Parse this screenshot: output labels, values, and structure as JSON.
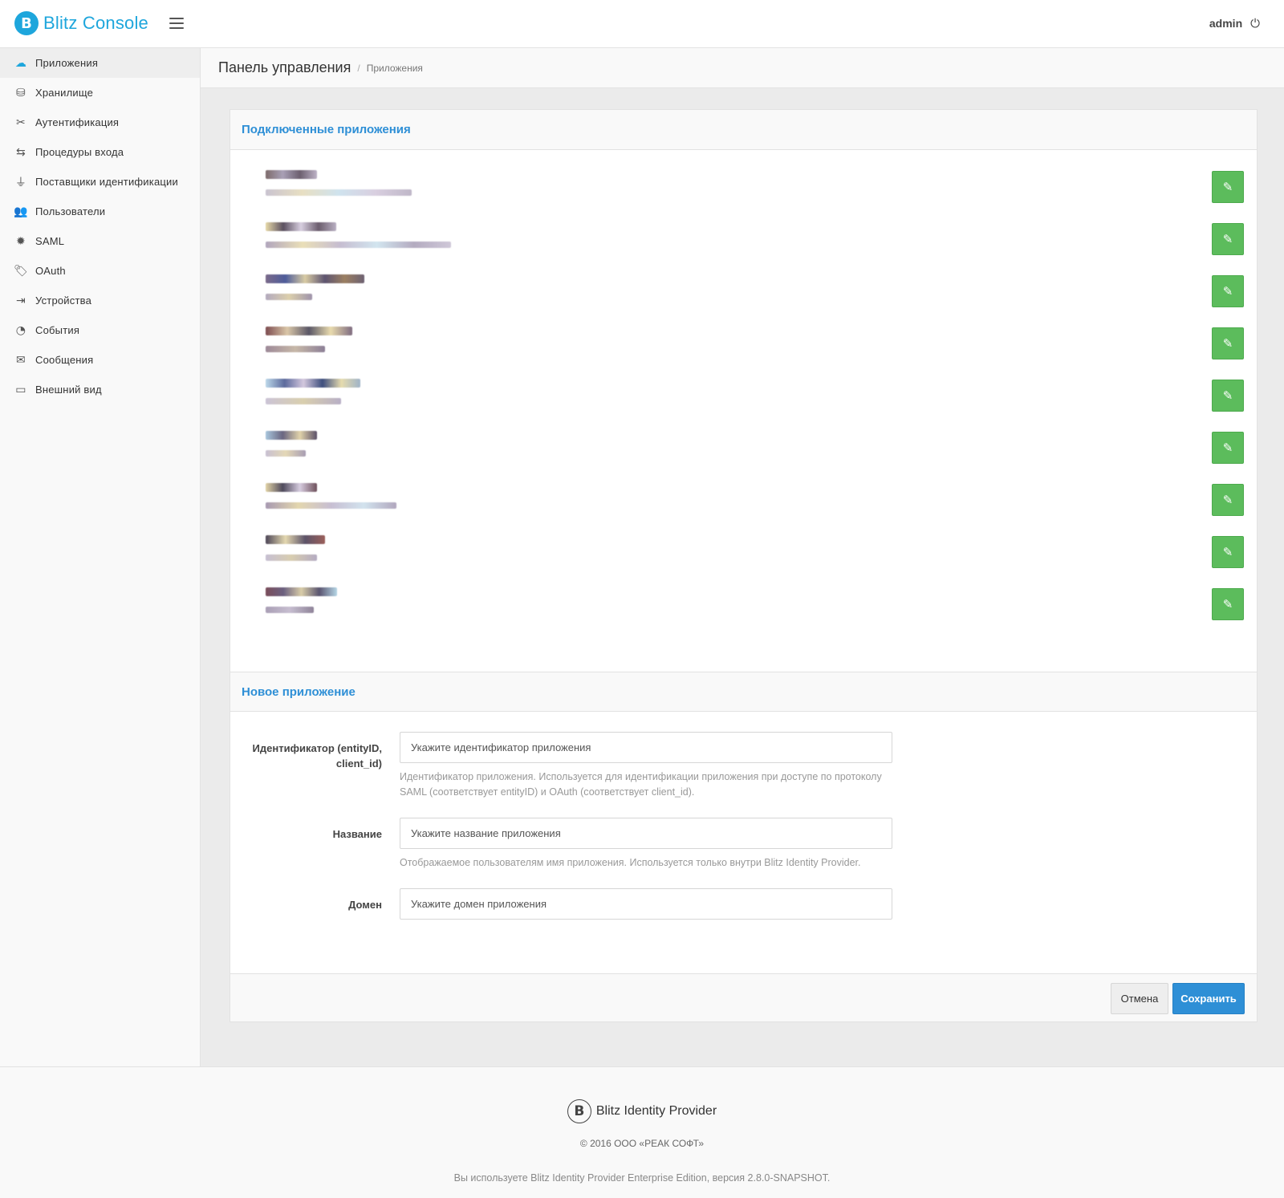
{
  "header": {
    "logo_letter": "B",
    "app_title": "Blitz Console",
    "user_name": "admin",
    "power_icon": "⏻"
  },
  "sidebar": {
    "items": [
      {
        "label": "Приложения",
        "icon": "☁",
        "active": true
      },
      {
        "label": "Хранилище",
        "icon": "⛁"
      },
      {
        "label": "Аутентификация",
        "icon": "✂"
      },
      {
        "label": "Процедуры входа",
        "icon": "⇆"
      },
      {
        "label": "Поставщики идентификации",
        "icon": "⏚"
      },
      {
        "label": "Пользователи",
        "icon": "👥"
      },
      {
        "label": "SAML",
        "icon": "✹"
      },
      {
        "label": "OAuth",
        "icon": "🏷"
      },
      {
        "label": "Устройства",
        "icon": "⇥"
      },
      {
        "label": "События",
        "icon": "◔"
      },
      {
        "label": "Сообщения",
        "icon": "✉"
      },
      {
        "label": "Внешний вид",
        "icon": "▭"
      }
    ]
  },
  "page": {
    "title": "Панель управления",
    "breadcrumb_sep": "/",
    "breadcrumb": "Приложения"
  },
  "connected_apps": {
    "heading": "Подключенные приложения",
    "edit_icon": "✎",
    "count": 9,
    "redacted": true
  },
  "new_app": {
    "heading": "Новое приложение",
    "fields": [
      {
        "label": "Идентификатор (entityID, client_id)",
        "placeholder": "Укажите идентификатор приложения",
        "value": "",
        "help": "Идентификатор приложения. Используется для идентификации приложения при доступе по протоколу SAML (соответствует entityID) и OAuth (соответствует client_id)."
      },
      {
        "label": "Название",
        "placeholder": "Укажите название приложения",
        "value": "",
        "help": "Отображаемое пользователям имя приложения. Используется только внутри Blitz Identity Provider."
      },
      {
        "label": "Домен",
        "placeholder": "Укажите домен приложения",
        "value": "",
        "help": ""
      }
    ],
    "cancel_label": "Отмена",
    "save_label": "Сохранить"
  },
  "footer": {
    "logo_letter": "B",
    "brand": "Blitz Identity Provider",
    "copyright": "© 2016 ООО «РЕАК СОФТ»",
    "version_text": "Вы используете Blitz Identity Provider Enterprise Edition, версия 2.8.0-SNAPSHOT."
  },
  "colors": {
    "brand": "#1ea6dc",
    "heading": "#2e8fd6",
    "edit_button": "#5cbc5c",
    "save_button": "#2e8fd6"
  }
}
